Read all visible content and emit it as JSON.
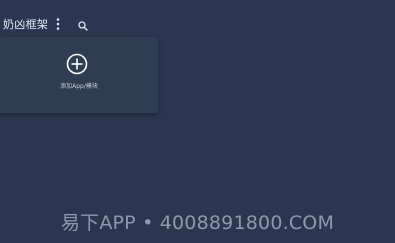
{
  "header": {
    "title": "奶凶框架",
    "more_icon": "more-vertical-icon",
    "search_icon": "search-icon"
  },
  "card": {
    "add_icon": "add-circle-icon",
    "label": "添加App/模块"
  },
  "watermark": {
    "text": "易下APP • 4008891800.COM"
  },
  "colors": {
    "background": "#2b3750",
    "card": "#2e3d51",
    "text": "#e6ecf4"
  }
}
